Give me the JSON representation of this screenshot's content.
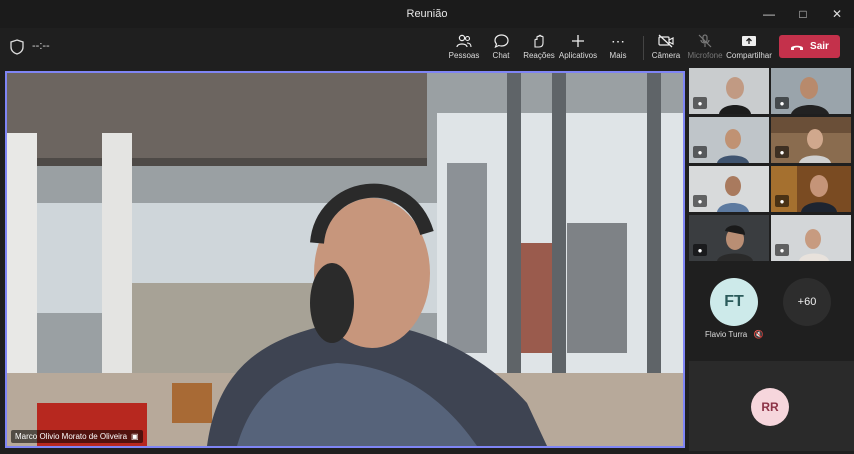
{
  "window": {
    "title": "Reunião"
  },
  "toolbar": {
    "timer": "--:--",
    "buttons": {
      "people": "Pessoas",
      "chat": "Chat",
      "reactions": "Reações",
      "apps": "Aplicativos",
      "more": "Mais",
      "camera": "Câmera",
      "mic": "Microfone",
      "share": "Compartilhar"
    },
    "leave_label": "Sair"
  },
  "main_video": {
    "participant_name": "Marco Olivio Morato de Oliveira"
  },
  "side_panel": {
    "ft": {
      "initials": "FT",
      "name": "Flavio Turra"
    },
    "overflow_count": "+60",
    "rr": {
      "initials": "RR"
    }
  },
  "colors": {
    "accent": "#7f85f5",
    "leave": "#c4314b"
  }
}
